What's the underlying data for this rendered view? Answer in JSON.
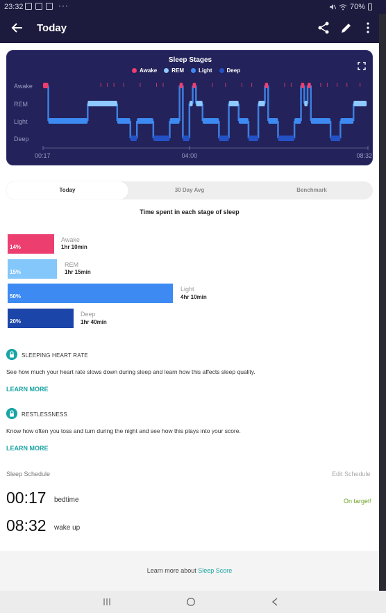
{
  "status_bar": {
    "time": "23:32",
    "battery": "70%"
  },
  "header": {
    "title": "Today"
  },
  "chart": {
    "title": "Sleep Stages",
    "legend": [
      {
        "label": "Awake",
        "color": "#f03e6e"
      },
      {
        "label": "REM",
        "color": "#8ec9ff"
      },
      {
        "label": "Light",
        "color": "#3d8bf2"
      },
      {
        "label": "Deep",
        "color": "#1b3fa3"
      }
    ],
    "y_labels": [
      "Awake",
      "REM",
      "Light",
      "Deep"
    ],
    "x_labels": [
      "00:17",
      "04:00",
      "08:32"
    ]
  },
  "chart_data": {
    "type": "line",
    "title": "Sleep Stages",
    "x_range": [
      "00:17",
      "08:32"
    ],
    "y_categories": [
      "Awake",
      "REM",
      "Light",
      "Deep"
    ],
    "segments": [
      {
        "start": "00:17",
        "end": "00:25",
        "stage": "Awake"
      },
      {
        "start": "00:25",
        "end": "01:25",
        "stage": "Light"
      },
      {
        "start": "01:25",
        "end": "02:10",
        "stage": "REM"
      },
      {
        "start": "02:10",
        "end": "02:30",
        "stage": "Light"
      },
      {
        "start": "02:30",
        "end": "02:40",
        "stage": "Deep"
      },
      {
        "start": "02:40",
        "end": "03:05",
        "stage": "Light"
      },
      {
        "start": "03:05",
        "end": "03:30",
        "stage": "Deep"
      },
      {
        "start": "03:30",
        "end": "03:45",
        "stage": "Light"
      },
      {
        "start": "03:45",
        "end": "03:50",
        "stage": "Awake"
      },
      {
        "start": "03:50",
        "end": "04:00",
        "stage": "Deep"
      },
      {
        "start": "04:00",
        "end": "04:05",
        "stage": "REM"
      },
      {
        "start": "04:05",
        "end": "04:10",
        "stage": "Awake"
      },
      {
        "start": "04:10",
        "end": "04:20",
        "stage": "REM"
      },
      {
        "start": "04:20",
        "end": "04:45",
        "stage": "Light"
      },
      {
        "start": "04:45",
        "end": "05:00",
        "stage": "Deep"
      },
      {
        "start": "05:00",
        "end": "05:15",
        "stage": "REM"
      },
      {
        "start": "05:15",
        "end": "05:30",
        "stage": "Light"
      },
      {
        "start": "05:30",
        "end": "05:45",
        "stage": "Deep"
      },
      {
        "start": "05:45",
        "end": "05:55",
        "stage": "REM"
      },
      {
        "start": "05:55",
        "end": "06:00",
        "stage": "Awake"
      },
      {
        "start": "06:00",
        "end": "06:15",
        "stage": "Light"
      },
      {
        "start": "06:15",
        "end": "06:40",
        "stage": "Deep"
      },
      {
        "start": "06:40",
        "end": "06:50",
        "stage": "Light"
      },
      {
        "start": "06:50",
        "end": "06:55",
        "stage": "Awake"
      },
      {
        "start": "06:55",
        "end": "07:00",
        "stage": "REM"
      },
      {
        "start": "07:00",
        "end": "07:05",
        "stage": "Awake"
      },
      {
        "start": "07:05",
        "end": "07:35",
        "stage": "Light"
      },
      {
        "start": "07:35",
        "end": "07:50",
        "stage": "Deep"
      },
      {
        "start": "07:50",
        "end": "08:10",
        "stage": "Light"
      },
      {
        "start": "08:10",
        "end": "08:30",
        "stage": "REM"
      }
    ]
  },
  "tabs": [
    {
      "label": "Today",
      "active": true
    },
    {
      "label": "30 Day Avg",
      "active": false
    },
    {
      "label": "Benchmark",
      "active": false
    }
  ],
  "stages_title": "Time spent in each stage of sleep",
  "stages": [
    {
      "name": "Awake",
      "percent": "14%",
      "duration": "1hr 10min",
      "color": "#ec3f70"
    },
    {
      "name": "REM",
      "percent": "15%",
      "duration": "1hr 15min",
      "color": "#84c7fb"
    },
    {
      "name": "Light",
      "percent": "50%",
      "duration": "4hr 10min",
      "color": "#3d8af2"
    },
    {
      "name": "Deep",
      "percent": "20%",
      "duration": "1hr 40min",
      "color": "#1b45a8"
    }
  ],
  "heart_rate": {
    "heading": "SLEEPING HEART RATE",
    "text": "See how much your heart rate slows down during sleep and learn how this affects sleep quality.",
    "link": "LEARN MORE"
  },
  "restlessness": {
    "heading": "RESTLESSNESS",
    "text": "Know how often you toss and turn during the night and see how this plays into your score.",
    "link": "LEARN MORE"
  },
  "schedule": {
    "heading": "Sleep Schedule",
    "edit": "Edit Schedule",
    "bedtime": "00:17",
    "bedtime_label": "bedtime",
    "status": "On target!",
    "wake": "08:32",
    "wake_label": "wake up"
  },
  "footer": {
    "text": "Learn more about",
    "link": "Sleep Score"
  }
}
